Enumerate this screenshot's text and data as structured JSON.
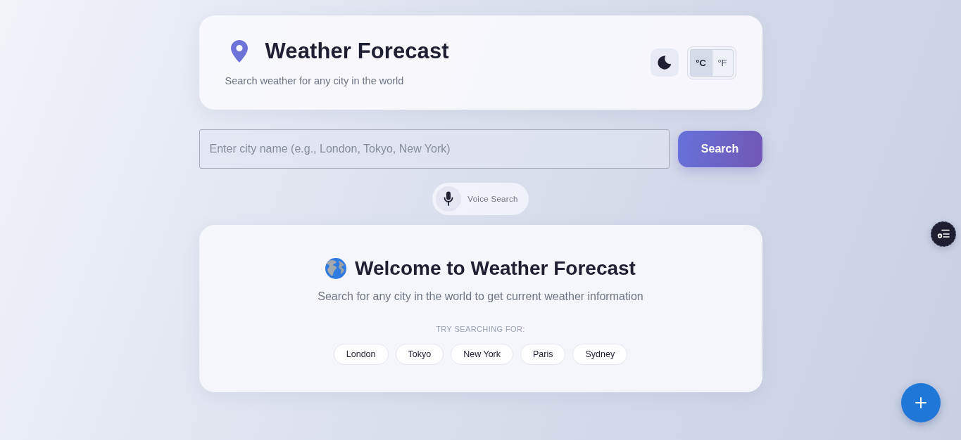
{
  "header": {
    "title": "Weather Forecast",
    "subtitle": "Search weather for any city in the world",
    "units": [
      {
        "label": "°C",
        "selected": true
      },
      {
        "label": "°F",
        "selected": false
      }
    ]
  },
  "search": {
    "placeholder": "Enter city name (e.g., London, Tokyo, New York)",
    "button": "Search"
  },
  "voice_search": {
    "label": "Voice Search"
  },
  "welcome": {
    "title": "Welcome to Weather Forecast",
    "subtitle": "Search for any city in the world to get current weather information",
    "suggestions_label": "TRY SEARCHING FOR:",
    "suggestions": [
      "London",
      "Tokyo",
      "New York",
      "Paris",
      "Sydney"
    ]
  }
}
